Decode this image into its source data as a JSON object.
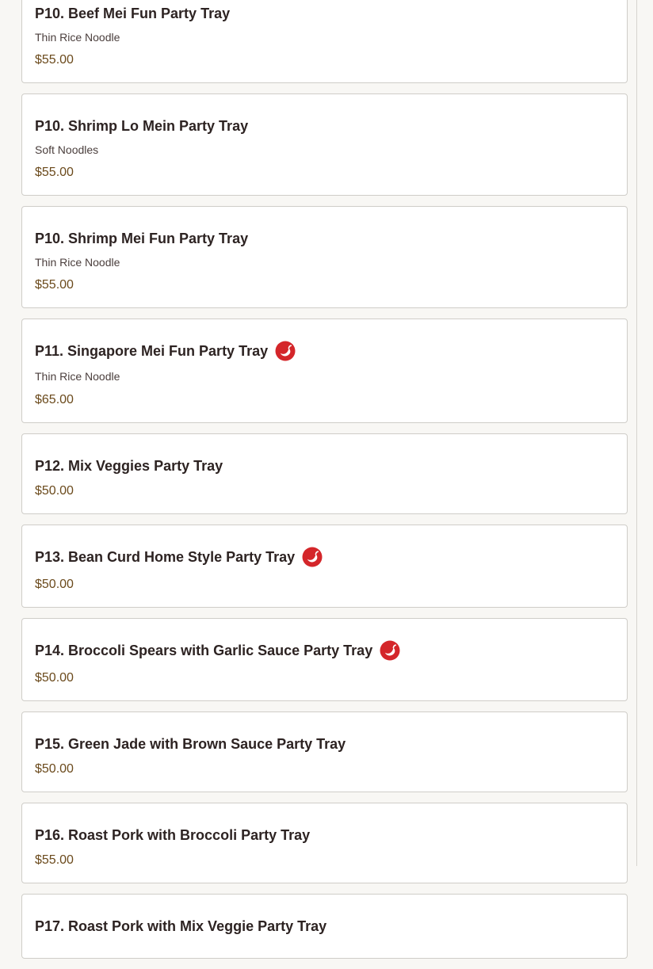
{
  "menu": {
    "items": [
      {
        "title": "P10. Beef Mei Fun Party Tray",
        "description": "Thin Rice Noodle",
        "price": "$55.00",
        "spicy": false
      },
      {
        "title": "P10. Shrimp Lo Mein Party Tray",
        "description": "Soft Noodles",
        "price": "$55.00",
        "spicy": false
      },
      {
        "title": "P10. Shrimp Mei Fun Party Tray",
        "description": "Thin Rice Noodle",
        "price": "$55.00",
        "spicy": false
      },
      {
        "title": "P11. Singapore Mei Fun Party Tray",
        "description": "Thin Rice Noodle",
        "price": "$65.00",
        "spicy": true
      },
      {
        "title": "P12. Mix Veggies Party Tray",
        "description": "",
        "price": "$50.00",
        "spicy": false
      },
      {
        "title": "P13. Bean Curd Home Style Party Tray",
        "description": "",
        "price": "$50.00",
        "spicy": true
      },
      {
        "title": "P14. Broccoli Spears with Garlic Sauce Party Tray",
        "description": "",
        "price": "$50.00",
        "spicy": true
      },
      {
        "title": "P15. Green Jade with Brown Sauce Party Tray",
        "description": "",
        "price": "$50.00",
        "spicy": false
      },
      {
        "title": "P16. Roast Pork with Broccoli Party Tray",
        "description": "",
        "price": "$55.00",
        "spicy": false
      },
      {
        "title": "P17. Roast Pork with Mix Veggie Party Tray",
        "description": "",
        "price": "",
        "spicy": false
      }
    ],
    "spicy_icon": "chili-pepper-icon",
    "colors": {
      "spicy": "#d4262a",
      "price": "#6b4a1c",
      "title": "#2d2322"
    }
  }
}
